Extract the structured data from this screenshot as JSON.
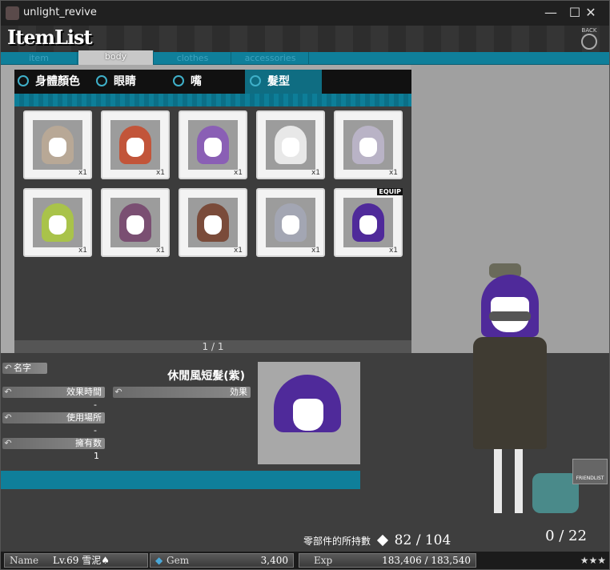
{
  "window": {
    "title": "unlight_revive",
    "minimize": "—",
    "maximize": "☐",
    "close": "✕"
  },
  "header": {
    "logo": "ItemList",
    "back_label": "BACK"
  },
  "tabs": [
    {
      "label": "item",
      "active": false
    },
    {
      "label": "body",
      "active": true
    },
    {
      "label": "clothes",
      "active": false
    },
    {
      "label": "accessories",
      "active": false
    }
  ],
  "subtabs": [
    {
      "label": "身體顏色",
      "active": false
    },
    {
      "label": "眼睛",
      "active": false
    },
    {
      "label": "嘴",
      "active": false
    },
    {
      "label": "髮型",
      "active": true
    }
  ],
  "items": [
    {
      "qty": "x1",
      "color": "#b8a896",
      "equipped": false
    },
    {
      "qty": "x1",
      "color": "#c2553a",
      "equipped": false
    },
    {
      "qty": "x1",
      "color": "#8a5fb5",
      "equipped": false
    },
    {
      "qty": "x1",
      "color": "#e8e8e8",
      "equipped": false
    },
    {
      "qty": "x1",
      "color": "#b9b3c6",
      "equipped": false
    },
    {
      "qty": "x1",
      "color": "#a9c34a",
      "equipped": false
    },
    {
      "qty": "x1",
      "color": "#7a4f72",
      "equipped": false
    },
    {
      "qty": "x1",
      "color": "#7a4b3a",
      "equipped": false
    },
    {
      "qty": "x1",
      "color": "#a3a6b3",
      "equipped": false
    },
    {
      "qty": "x1",
      "color": "#4f2a9a",
      "equipped": true
    }
  ],
  "equip_label": "EQUIP",
  "pager": "1 / 1",
  "detail": {
    "name_label": "名字",
    "name_value": "休閒風短髮(紫)",
    "duration_label": "效果時間",
    "duration_value": "-",
    "effect_label": "効果",
    "location_label": "使用場所",
    "location_value": "-",
    "owned_label": "擁有数",
    "owned_value": "1"
  },
  "parts": {
    "label": "零部件的所持數",
    "value": "82 / 104"
  },
  "status": {
    "name_label": "Name",
    "name_value": "Lv.69 雪泥♠",
    "gem_label": "Gem",
    "gem_value": "3,400",
    "exp_label": "Exp",
    "exp_value": "183,406 / 183,540"
  },
  "friendlist_label": "FRIENDLIST",
  "gauge": "0 / 22",
  "stars": "★★★"
}
